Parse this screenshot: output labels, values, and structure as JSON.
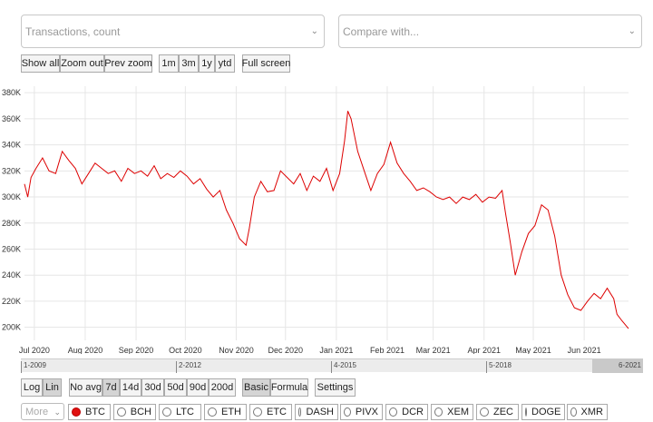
{
  "metric_select": {
    "value": "Transactions, count"
  },
  "compare_select": {
    "value": "Compare with..."
  },
  "zoom_buttons": [
    "Show all",
    "Zoom out",
    "Prev zoom"
  ],
  "range_buttons": [
    "1m",
    "3m",
    "1y",
    "ytd"
  ],
  "fullscreen_label": "Full screen",
  "scale_buttons": [
    "Log",
    "Lin"
  ],
  "avg_buttons": [
    "No avg",
    "7d",
    "14d",
    "30d",
    "50d",
    "90d",
    "200d"
  ],
  "mode_buttons": [
    "Basic",
    "Formula"
  ],
  "settings_label": "Settings",
  "more_select": "More",
  "coins": [
    "BTC",
    "BCH",
    "LTC",
    "ETH",
    "ETC",
    "DASH",
    "PIVX",
    "DCR",
    "XEM",
    "ZEC",
    "DOGE",
    "XMR"
  ],
  "selected_coin": "BTC",
  "navigator_labels": [
    "1-2009",
    "2-2012",
    "4-2015",
    "5-2018",
    "6-2021"
  ],
  "colors": {
    "series": "#dd0000",
    "grid": "#e6e6e6"
  },
  "chart_data": {
    "type": "line",
    "yticks": [
      "200K",
      "220K",
      "240K",
      "260K",
      "280K",
      "300K",
      "320K",
      "340K",
      "360K",
      "380K"
    ],
    "xticks": [
      "Jul 2020",
      "Aug 2020",
      "Sep 2020",
      "Oct 2020",
      "Nov 2020",
      "Dec 2020",
      "Jan 2021",
      "Feb 2021",
      "Mar 2021",
      "Apr 2021",
      "May 2021",
      "Jun 2021"
    ],
    "ylim": [
      190000,
      385000
    ],
    "xlim": [
      "2020-06-25",
      "2021-06-28"
    ],
    "series": [
      {
        "x": [
          "2020-06-25",
          "2020-06-27",
          "2020-06-29",
          "2020-07-02",
          "2020-07-06",
          "2020-07-10",
          "2020-07-14",
          "2020-07-18",
          "2020-07-22",
          "2020-07-26",
          "2020-07-30",
          "2020-08-03",
          "2020-08-07",
          "2020-08-11",
          "2020-08-15",
          "2020-08-19",
          "2020-08-23",
          "2020-08-27",
          "2020-08-31",
          "2020-09-04",
          "2020-09-08",
          "2020-09-12",
          "2020-09-16",
          "2020-09-20",
          "2020-09-24",
          "2020-09-28",
          "2020-10-02",
          "2020-10-06",
          "2020-10-10",
          "2020-10-14",
          "2020-10-18",
          "2020-10-22",
          "2020-10-26",
          "2020-10-30",
          "2020-11-03",
          "2020-11-07",
          "2020-11-09",
          "2020-11-12",
          "2020-11-16",
          "2020-11-20",
          "2020-11-24",
          "2020-11-28",
          "2020-12-02",
          "2020-12-06",
          "2020-12-10",
          "2020-12-14",
          "2020-12-18",
          "2020-12-22",
          "2020-12-26",
          "2020-12-30",
          "2021-01-03",
          "2021-01-06",
          "2021-01-08",
          "2021-01-10",
          "2021-01-14",
          "2021-01-18",
          "2021-01-22",
          "2021-01-26",
          "2021-01-30",
          "2021-02-03",
          "2021-02-07",
          "2021-02-11",
          "2021-02-15",
          "2021-02-19",
          "2021-02-23",
          "2021-02-27",
          "2021-03-03",
          "2021-03-07",
          "2021-03-11",
          "2021-03-15",
          "2021-03-19",
          "2021-03-23",
          "2021-03-27",
          "2021-03-31",
          "2021-04-04",
          "2021-04-08",
          "2021-04-12",
          "2021-04-14",
          "2021-04-17",
          "2021-04-20",
          "2021-04-24",
          "2021-04-28",
          "2021-05-02",
          "2021-05-06",
          "2021-05-10",
          "2021-05-14",
          "2021-05-18",
          "2021-05-22",
          "2021-05-26",
          "2021-05-30",
          "2021-06-03",
          "2021-06-07",
          "2021-06-11",
          "2021-06-15",
          "2021-06-19",
          "2021-06-21",
          "2021-06-24",
          "2021-06-28"
        ],
        "y": [
          310000,
          300000,
          315000,
          322000,
          330000,
          320000,
          318000,
          335000,
          328000,
          322000,
          310000,
          318000,
          326000,
          322000,
          318000,
          320000,
          312000,
          322000,
          318000,
          320000,
          316000,
          324000,
          314000,
          318000,
          315000,
          320000,
          316000,
          310000,
          314000,
          306000,
          300000,
          305000,
          290000,
          280000,
          268000,
          263000,
          276000,
          300000,
          312000,
          304000,
          305000,
          320000,
          315000,
          310000,
          318000,
          305000,
          316000,
          312000,
          322000,
          305000,
          318000,
          343000,
          366000,
          360000,
          335000,
          320000,
          305000,
          318000,
          325000,
          342000,
          326000,
          318000,
          312000,
          305000,
          307000,
          304000,
          300000,
          298000,
          300000,
          295000,
          300000,
          298000,
          302000,
          296000,
          300000,
          299000,
          305000,
          288000,
          265000,
          240000,
          258000,
          272000,
          278000,
          294000,
          290000,
          270000,
          240000,
          225000,
          215000,
          213000,
          220000,
          226000,
          222000,
          230000,
          222000,
          210000,
          205000,
          199000
        ]
      }
    ]
  }
}
